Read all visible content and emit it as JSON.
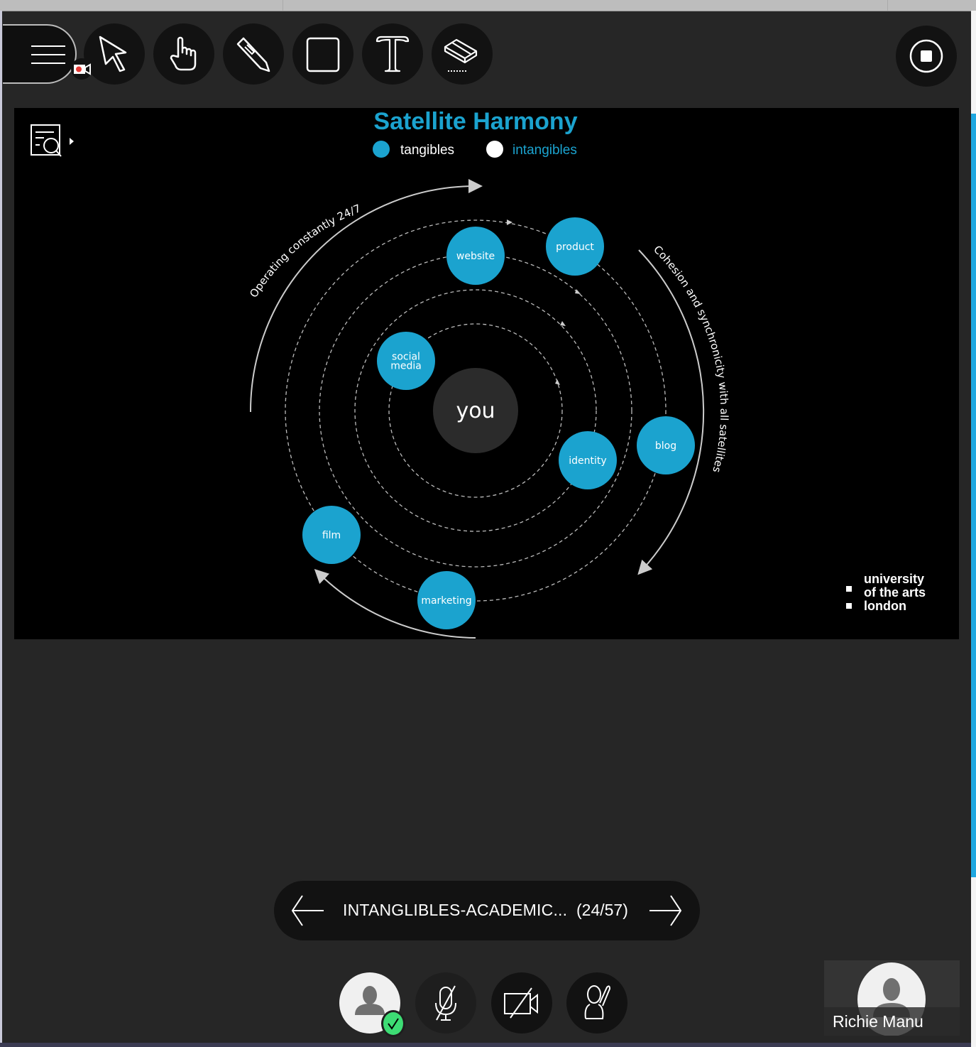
{
  "toolbar": {
    "tools": [
      {
        "name": "menu",
        "icon": "hamburger-icon"
      },
      {
        "name": "select",
        "icon": "arrow-pointer-icon"
      },
      {
        "name": "pan",
        "icon": "hand-icon"
      },
      {
        "name": "pen",
        "icon": "pencil-icon"
      },
      {
        "name": "shape",
        "icon": "square-icon"
      },
      {
        "name": "text",
        "icon": "text-icon"
      },
      {
        "name": "eraser",
        "icon": "eraser-icon"
      }
    ],
    "recording_indicator_color": "#e53935",
    "stop_icon": "stop-icon"
  },
  "slide": {
    "title": "Satellite Harmony",
    "legend": [
      {
        "label": "tangibles",
        "color": "#1ba3cf"
      },
      {
        "label": "intangibles",
        "color": "#ffffff"
      }
    ],
    "center": "you",
    "satellites": [
      "website",
      "product",
      "social media",
      "identity",
      "blog",
      "film",
      "marketing"
    ],
    "arc_left": "Operating constantly 24/7",
    "arc_right": "Cohesion  and synchronicity with all satellites",
    "logo": [
      "university",
      "of the arts",
      "london"
    ],
    "accent": "#1ba3cf"
  },
  "navigator": {
    "file_label": "INTANGLIBLES-ACADEMIC...",
    "page_count": "(24/57)"
  },
  "controls": {
    "status_color": "#3ddc74"
  },
  "participant": {
    "name": "Richie Manu"
  }
}
